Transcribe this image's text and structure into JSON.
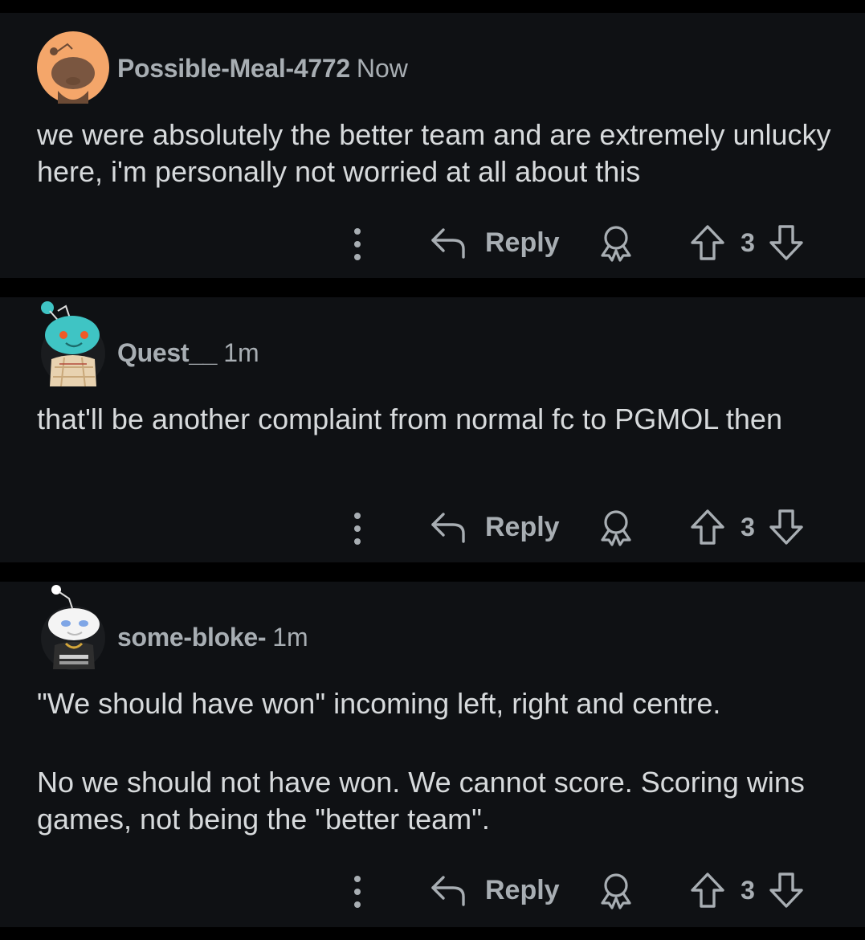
{
  "theme": {
    "background": "#000000",
    "card_background": "#0f1114",
    "text_primary": "#d7dadc",
    "text_secondary": "#a8aeb3"
  },
  "comments": [
    {
      "username": "Possible-Meal-4772",
      "time": "Now",
      "avatar_icon": "snoo-avatar-icon",
      "body": [
        "we were absolutely the better team and are extremely unlucky here, i'm personally not worried at all about this"
      ],
      "reply_label": "Reply",
      "score": "3"
    },
    {
      "username": "Quest__",
      "time": "1m",
      "avatar_icon": "snoo-avatar-icon",
      "body": [
        "that'll be another complaint from normal fc to PGMOL then"
      ],
      "reply_label": "Reply",
      "score": "3"
    },
    {
      "username": "some-bloke-",
      "time": "1m",
      "avatar_icon": "snoo-avatar-icon",
      "body": [
        "\"We should have won\" incoming left, right and centre.",
        "No we should not have won. We cannot score. Scoring wins games, not being the \"better team\"."
      ],
      "reply_label": "Reply",
      "score": "3"
    }
  ],
  "icons": [
    "more-options-icon",
    "reply-arrow-icon",
    "award-icon",
    "upvote-arrow-icon",
    "downvote-arrow-icon"
  ]
}
